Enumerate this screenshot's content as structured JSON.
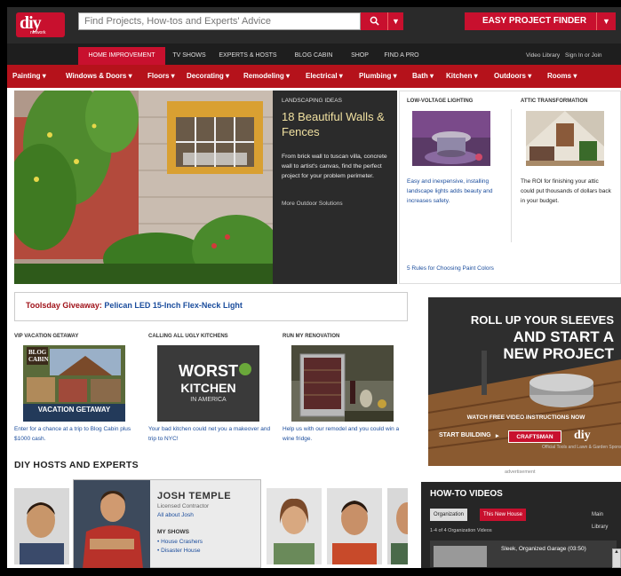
{
  "header": {
    "logo_text": "diy",
    "logo_sub": "network",
    "search_placeholder": "Find Projects, How-tos and Experts' Advice",
    "search_icon": "magnifier-icon",
    "finder_label": "EASY PROJECT FINDER"
  },
  "topnav": {
    "tabs": [
      "HOME IMPROVEMENT",
      "TV SHOWS",
      "EXPERTS & HOSTS",
      "BLOG CABIN",
      "SHOP",
      "FIND A PRO"
    ],
    "video_library": "Video Library",
    "sign_in": "Sign In or Join"
  },
  "catnav": [
    "Painting",
    "Windows & Doors",
    "Floors",
    "Decorating",
    "Remodeling",
    "Electrical",
    "Plumbing",
    "Bath",
    "Kitchen",
    "Outdoors",
    "Rooms"
  ],
  "hero": {
    "kicker": "LANDSCAPING IDEAS",
    "title": "18 Beautiful Walls & Fences",
    "desc": "From brick wall to tuscan villa, concrete wall to artist's canvas, find the perfect project for your problem perimeter.",
    "more": "More Outdoor Solutions"
  },
  "side": {
    "f1": {
      "kicker": "LOW-VOLTAGE LIGHTING",
      "desc": "Easy and inexpensive, installing landscape lights adds beauty and increases safety."
    },
    "f2": {
      "kicker": "ATTIC TRANSFORMATION",
      "desc": "The ROI for finishing your attic could put thousands of dollars back in your budget."
    },
    "footer": "5 Rules for Choosing Paint Colors"
  },
  "giveaway": {
    "label": "Toolsday Giveaway:",
    "link": "Pelican LED 15-Inch Flex-Neck Light"
  },
  "promos": [
    {
      "kicker": "VIP VACATION GETAWAY",
      "overlay": "VACATION GETAWAY",
      "badge": "BLOG CABIN",
      "desc": "Enter for a chance at a trip to Blog Cabin plus $1000 cash."
    },
    {
      "kicker": "CALLING ALL UGLY KITCHENS",
      "overlay1": "WORST",
      "overlay2": "KITCHEN",
      "overlay3": "IN AMERICA",
      "desc": "Your bad kitchen could net you a makeover and trip to NYC!"
    },
    {
      "kicker": "RUN MY RENOVATION",
      "desc": "Help us with our remodel and you could win a wine fridge."
    }
  ],
  "hosts": {
    "title": "DIY HOSTS AND EXPERTS",
    "featured": {
      "name": "JOSH TEMPLE",
      "role": "Licensed Contractor",
      "about": "All about Josh",
      "shows_label": "MY SHOWS",
      "shows": [
        "House Crashers",
        "Disaster House"
      ]
    }
  },
  "ad": {
    "line1": "ROLL UP YOUR SLEEVES",
    "line2": "AND START A",
    "line3": "NEW PROJECT",
    "sub": "WATCH FREE VIDEO INSTRUCTIONS NOW",
    "start": "START BUILDING",
    "brand": "CRAFTSMAN",
    "diy": "diy",
    "official": "Official Tools and Lawn & Garden Sponsor",
    "label": "advertisement"
  },
  "videos": {
    "title": "HOW-TO VIDEOS",
    "tabs": [
      "Organization",
      "This New House"
    ],
    "main_library": "Main Library",
    "count": "1-4 of 4 Organization Videos",
    "item": "Sleek, Organized Garage (03:50)"
  },
  "colors": {
    "brand_red": "#c8102e",
    "nav_red": "#b5121b",
    "dark": "#2a2a2a",
    "link": "#1a4c9c"
  }
}
